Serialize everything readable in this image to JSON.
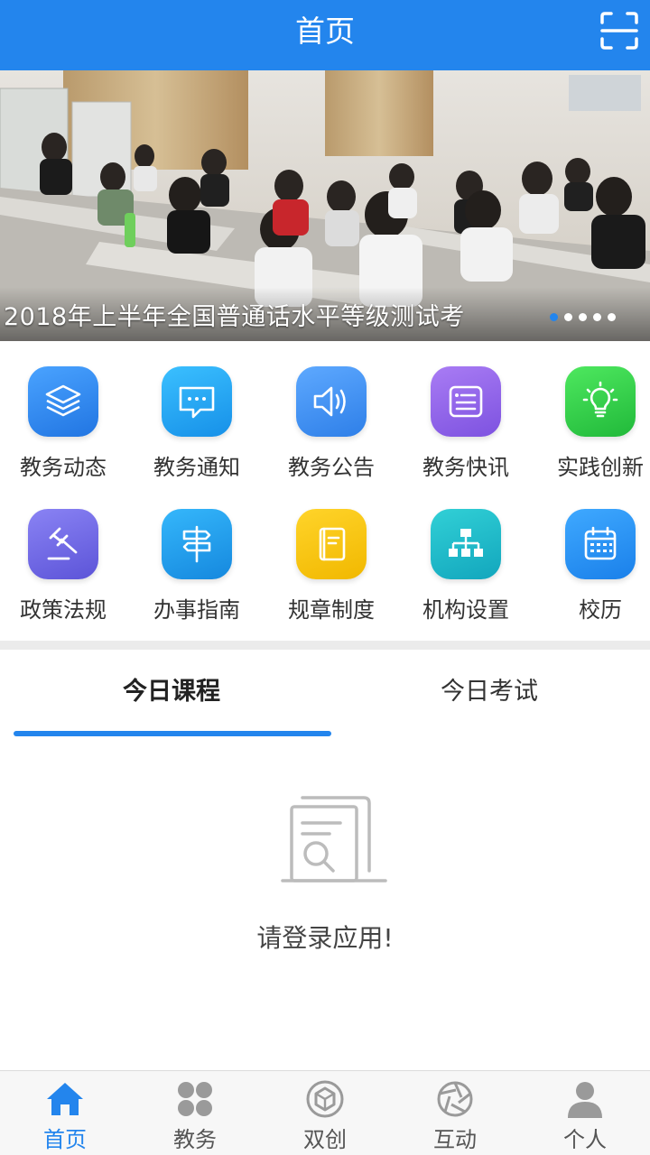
{
  "header": {
    "title": "首页",
    "scan_icon": "scan-icon"
  },
  "banner": {
    "caption": "2018年上半年全国普通话水平等级测试考",
    "slide_count": 5,
    "active_slide": 1
  },
  "grid": [
    {
      "label": "教务动态",
      "icon": "layers-icon",
      "color": "#2f8ef0"
    },
    {
      "label": "教务通知",
      "icon": "chat-bubble-icon",
      "color": "#1fa0ef"
    },
    {
      "label": "教务公告",
      "icon": "speaker-icon",
      "color": "#3a8ff3"
    },
    {
      "label": "教务快讯",
      "icon": "news-icon",
      "color": "#8e63e6"
    },
    {
      "label": "实践创新",
      "icon": "lightbulb-icon",
      "color": "#2ecc4a"
    },
    {
      "label": "政策法规",
      "icon": "gavel-icon",
      "color": "#6e67e0"
    },
    {
      "label": "办事指南",
      "icon": "signpost-icon",
      "color": "#1a9ee8"
    },
    {
      "label": "规章制度",
      "icon": "book-icon",
      "color": "#f7c300"
    },
    {
      "label": "机构设置",
      "icon": "org-chart-icon",
      "color": "#1fb7c8"
    },
    {
      "label": "校历",
      "icon": "calendar-icon",
      "color": "#1e90ef"
    }
  ],
  "tabs": {
    "today_courses": "今日课程",
    "today_exams": "今日考试",
    "active": "today_courses"
  },
  "empty_state": {
    "icon": "document-search-icon",
    "message": "请登录应用!"
  },
  "tabbar": [
    {
      "label": "首页",
      "icon": "home-icon",
      "active": true
    },
    {
      "label": "教务",
      "icon": "grid-dots-icon",
      "active": false
    },
    {
      "label": "双创",
      "icon": "cube-circle-icon",
      "active": false
    },
    {
      "label": "互动",
      "icon": "aperture-icon",
      "active": false
    },
    {
      "label": "个人",
      "icon": "person-icon",
      "active": false
    }
  ],
  "colors": {
    "primary": "#2385ed",
    "tab_inactive": "#9a9a9a"
  }
}
